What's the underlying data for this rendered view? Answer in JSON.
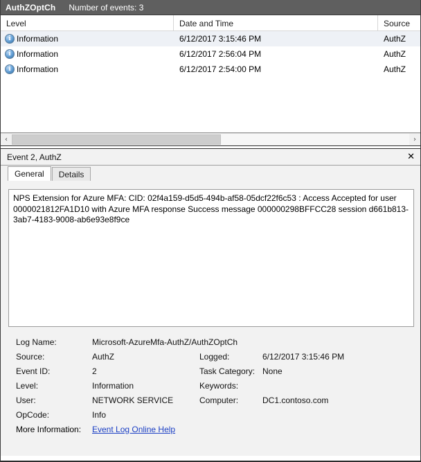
{
  "channel_header": {
    "channel_name": "AuthZOptCh",
    "event_count_label": "Number of events: 3"
  },
  "event_list": {
    "columns": [
      {
        "key": "level",
        "label": "Level"
      },
      {
        "key": "date",
        "label": "Date and Time"
      },
      {
        "key": "source",
        "label": "Source"
      }
    ],
    "rows": [
      {
        "icon": "information-icon",
        "level": "Information",
        "date": "6/12/2017 3:15:46 PM",
        "source": "AuthZ",
        "selected": true
      },
      {
        "icon": "information-icon",
        "level": "Information",
        "date": "6/12/2017 2:56:04 PM",
        "source": "AuthZ",
        "selected": false
      },
      {
        "icon": "information-icon",
        "level": "Information",
        "date": "6/12/2017 2:54:00 PM",
        "source": "AuthZ",
        "selected": false
      }
    ]
  },
  "scrollbar": {
    "left_arrow": "‹",
    "right_arrow": "›"
  },
  "detail": {
    "title": "Event 2, AuthZ",
    "close_label": "✕",
    "tabs": [
      {
        "label": "General",
        "active": true
      },
      {
        "label": "Details",
        "active": false
      }
    ],
    "message": "NPS Extension for Azure MFA:  CID: 02f4a159-d5d5-494b-af58-05dcf22f6c53 : Access Accepted for user 0000021812FA1D10 with Azure MFA response Success message 000000298BFFCC28 session d661b813-3ab7-4183-9008-ab6e93e8f9ce",
    "fields": {
      "log_name_label": "Log Name:",
      "log_name_value": "Microsoft-AzureMfa-AuthZ/AuthZOptCh",
      "source_label": "Source:",
      "source_value": "AuthZ",
      "logged_label": "Logged:",
      "logged_value": "6/12/2017 3:15:46 PM",
      "event_id_label": "Event ID:",
      "event_id_value": "2",
      "task_category_label": "Task Category:",
      "task_category_value": "None",
      "level_label": "Level:",
      "level_value": "Information",
      "keywords_label": "Keywords:",
      "keywords_value": "",
      "user_label": "User:",
      "user_value": "NETWORK SERVICE",
      "computer_label": "Computer:",
      "computer_value": "DC1.contoso.com",
      "opcode_label": "OpCode:",
      "opcode_value": "Info",
      "more_info_label": "More Information:",
      "more_info_link": "Event Log Online Help"
    }
  },
  "colors": {
    "header_bar": "#5f5f5f",
    "selection": "#eef1f6",
    "link": "#1b3fc4",
    "info_icon": "#2b6ca3"
  }
}
